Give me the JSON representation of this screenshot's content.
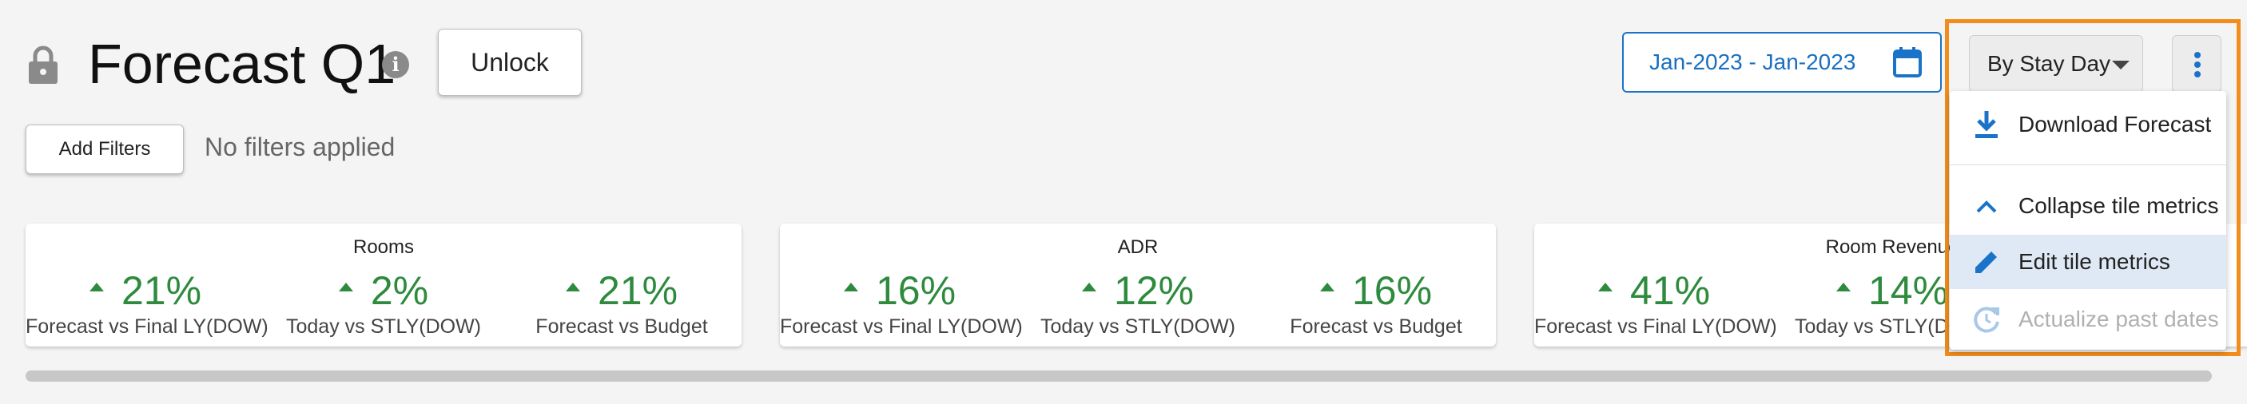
{
  "header": {
    "lock_icon": "lock-icon",
    "title": "Forecast Q1",
    "info_icon": "info-icon",
    "unlock_label": "Unlock"
  },
  "filters": {
    "add_label": "Add Filters",
    "status": "No filters applied"
  },
  "date_range": {
    "value": "Jan-2023 - Jan-2023",
    "icon": "calendar-icon"
  },
  "view_select": {
    "value": "By Stay Day"
  },
  "more_menu": {
    "icon": "more-vertical-icon",
    "items": [
      {
        "label": "Download Forecast",
        "icon": "download-icon",
        "state": "normal"
      },
      {
        "label": "Collapse tile metrics",
        "icon": "chevron-up-icon",
        "state": "normal"
      },
      {
        "label": "Edit tile metrics",
        "icon": "pencil-icon",
        "state": "selected"
      },
      {
        "label": "Actualize past dates",
        "icon": "refresh-icon",
        "state": "disabled"
      }
    ]
  },
  "tiles": [
    {
      "title": "Rooms",
      "metrics": [
        {
          "value": "21%",
          "label": "Forecast vs Final LY(DOW)"
        },
        {
          "value": "2%",
          "label": "Today vs STLY(DOW)"
        },
        {
          "value": "21%",
          "label": "Forecast vs Budget"
        }
      ]
    },
    {
      "title": "ADR",
      "metrics": [
        {
          "value": "16%",
          "label": "Forecast vs Final LY(DOW)"
        },
        {
          "value": "12%",
          "label": "Today vs STLY(DOW)"
        },
        {
          "value": "16%",
          "label": "Forecast vs Budget"
        }
      ]
    },
    {
      "title": "Room Revenue",
      "metrics": [
        {
          "value": "41%",
          "label": "Forecast vs Final LY(DOW)"
        },
        {
          "value": "14%",
          "label": "Today vs STLY(DOW)"
        }
      ]
    }
  ],
  "colors": {
    "accent": "#1a73c8",
    "positive": "#2e8b3d",
    "highlight": "#f28c1b"
  }
}
